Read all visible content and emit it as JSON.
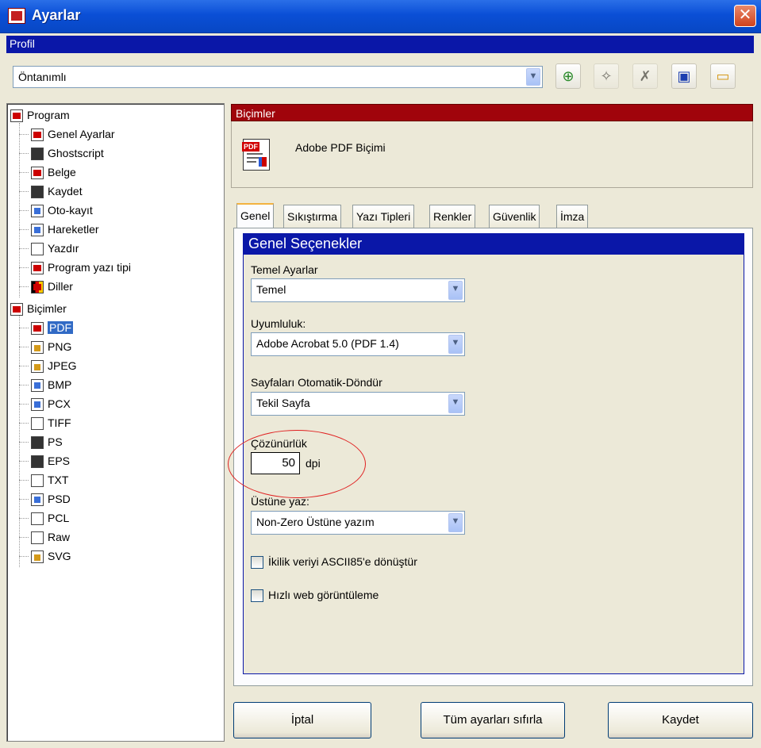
{
  "window": {
    "title": "Ayarlar",
    "close_glyph": "✕"
  },
  "profile": {
    "header": "Profil",
    "selected": "Öntanımlı"
  },
  "toolbar": {
    "buttons": [
      {
        "name": "add-profile-button",
        "icon": "add-profile-icon",
        "glyph": "⊕"
      },
      {
        "name": "rename-profile-button",
        "icon": "rename-profile-icon",
        "glyph": "✧"
      },
      {
        "name": "delete-profile-button",
        "icon": "delete-profile-icon",
        "glyph": "✗"
      },
      {
        "name": "save-profile-button",
        "icon": "floppy-disk-icon",
        "glyph": "▣"
      },
      {
        "name": "open-profile-button",
        "icon": "folder-icon",
        "glyph": "▭"
      }
    ]
  },
  "tree": {
    "program": {
      "label": "Program",
      "items": [
        "Genel Ayarlar",
        "Ghostscript",
        "Belge",
        "Kaydet",
        "Oto-kayıt",
        "Hareketler",
        "Yazdır",
        "Program yazı tipi",
        "Diller"
      ]
    },
    "formats": {
      "label": "Biçimler",
      "items": [
        "PDF",
        "PNG",
        "JPEG",
        "BMP",
        "PCX",
        "TIFF",
        "PS",
        "EPS",
        "TXT",
        "PSD",
        "PCL",
        "Raw",
        "SVG"
      ],
      "selected": "PDF"
    }
  },
  "panel": {
    "header": "Biçimler",
    "format_name": "Adobe PDF Biçimi",
    "icon_tag": "PDF"
  },
  "tabs": [
    "Genel",
    "Sıkıştırma",
    "Yazı Tipleri",
    "Renkler",
    "Güvenlik",
    "İmza"
  ],
  "general": {
    "title": "Genel Seçenekler",
    "basic_label": "Temel Ayarlar",
    "basic_value": "Temel",
    "compat_label": "Uyumluluk:",
    "compat_value": "Adobe Acrobat 5.0 (PDF 1.4)",
    "rotate_label": "Sayfaları Otomatik-Döndür",
    "rotate_value": "Tekil Sayfa",
    "resolution_label": "Çözünürlük",
    "resolution_value": "50",
    "resolution_unit": "dpi",
    "overprint_label": "Üstüne yaz:",
    "overprint_value": "Non-Zero Üstüne yazım",
    "ascii85_label": "İkilik veriyi ASCII85'e dönüştür",
    "fastweb_label": "Hızlı web görüntüleme"
  },
  "buttons": {
    "cancel": "İptal",
    "reset": "Tüm ayarları sıfırla",
    "save": "Kaydet"
  },
  "colors": {
    "title_bar": "#0a4fd6",
    "section_header": "#a0040b",
    "group_header": "#0a17a8",
    "highlight_ellipse": "#e02020"
  }
}
